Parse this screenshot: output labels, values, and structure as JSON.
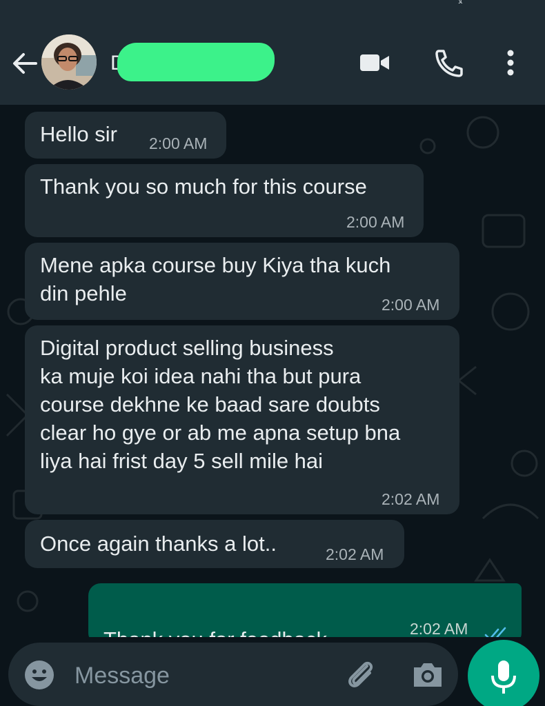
{
  "header": {
    "status_text": "ﻼ",
    "contact_name": "D",
    "back_label": "Back",
    "icons": [
      "back-arrow-icon",
      "video-call-icon",
      "voice-call-icon",
      "more-options-icon"
    ]
  },
  "messages": [
    {
      "direction": "in",
      "text": "Hello sir",
      "time": "2:00 AM"
    },
    {
      "direction": "in",
      "text": "Thank you so much for this course",
      "time": "2:00 AM"
    },
    {
      "direction": "in",
      "text": "Mene apka course buy Kiya tha kuch\ndin pehle",
      "time": "2:00 AM"
    },
    {
      "direction": "in",
      "text": "Digital product selling business\nka muje koi idea nahi tha but pura\ncourse dekhne ke baad sare doubts\nclear ho gye or ab me apna setup bna\nliya hai frist day 5 sell mile hai",
      "time": "2:02 AM"
    },
    {
      "direction": "in",
      "text": "Once again thanks a lot..",
      "time": "2:02 AM"
    },
    {
      "direction": "out",
      "text": "Thank you for feedback",
      "emoji": "🙏",
      "time": "2:02 AM",
      "status": "read"
    }
  ],
  "composer": {
    "placeholder": "Message",
    "icons": [
      "emoji-icon",
      "attach-icon",
      "camera-icon",
      "mic-icon"
    ]
  },
  "colors": {
    "header_bg": "#1f2c34",
    "chat_bg": "#0b141a",
    "incoming_bubble": "#202c33",
    "outgoing_bubble": "#005c4b",
    "accent": "#00a884",
    "read_ticks": "#53bdeb",
    "redaction": "#3cf28a"
  }
}
